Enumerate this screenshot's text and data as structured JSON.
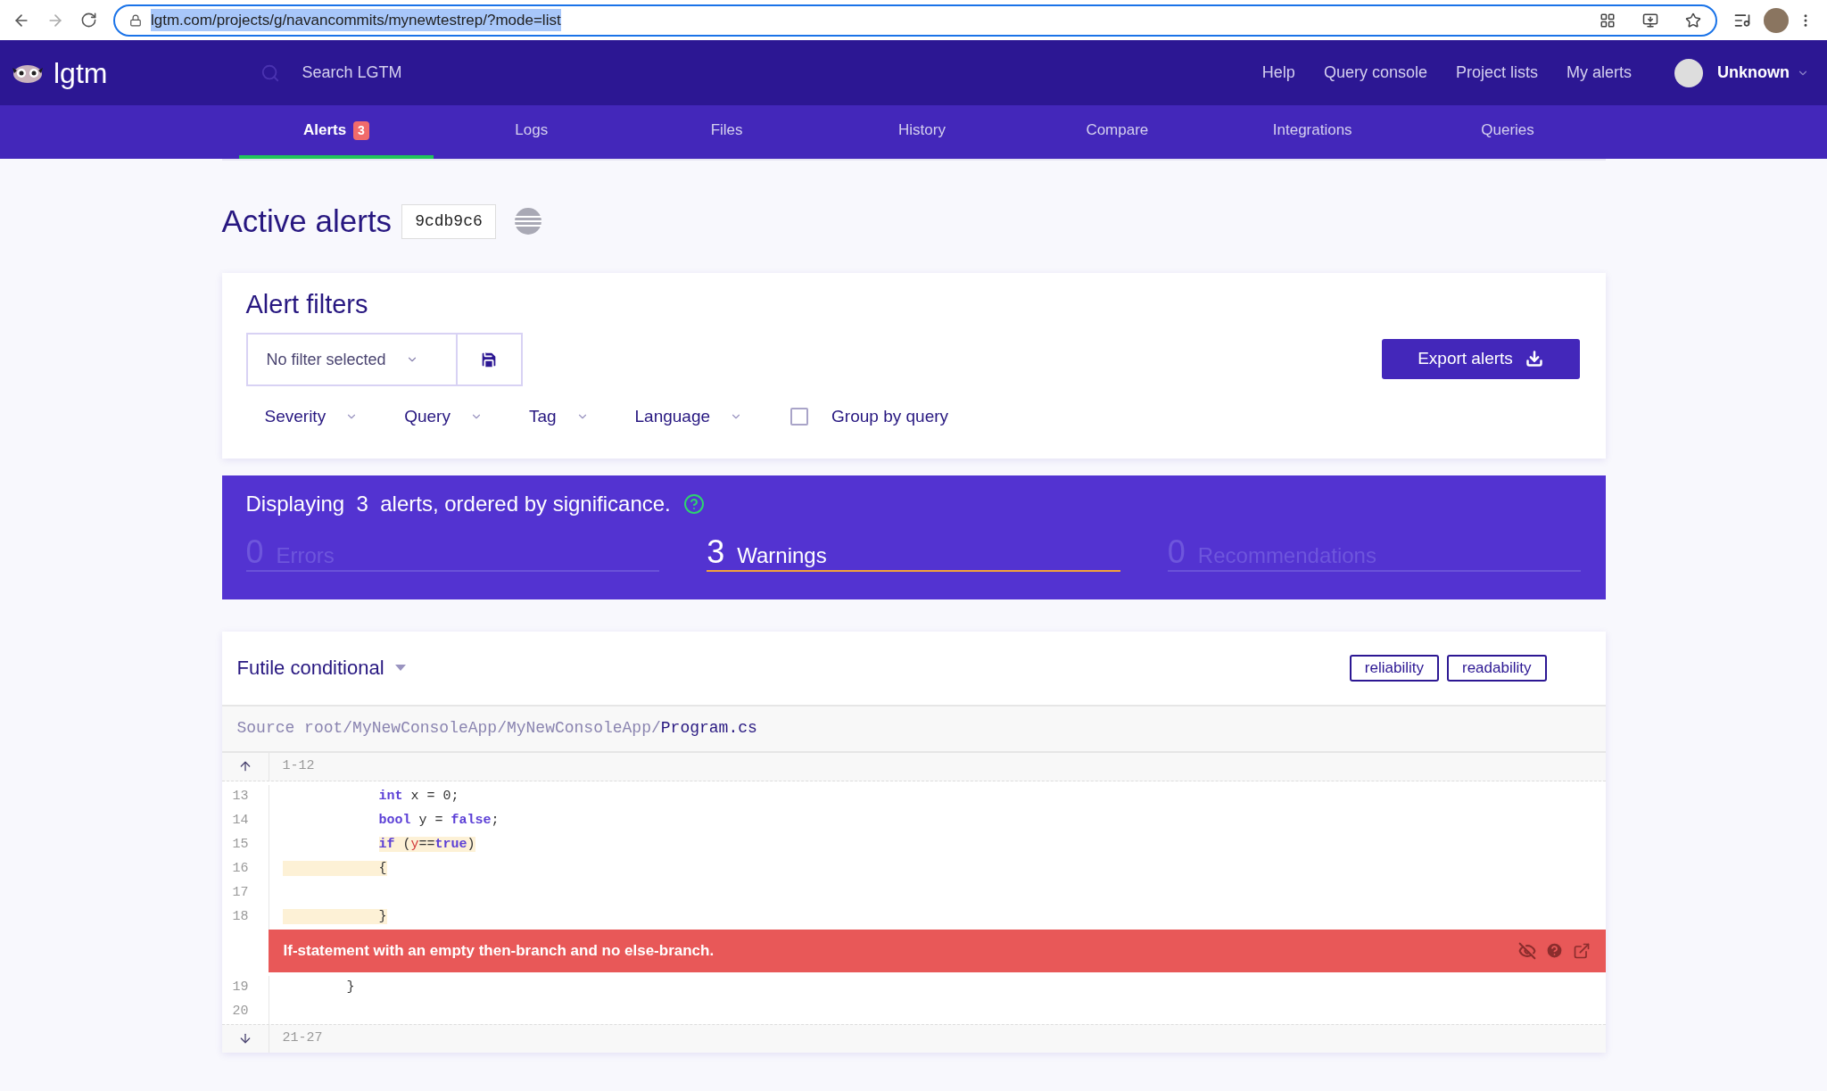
{
  "browser": {
    "url": "lgtm.com/projects/g/navancommits/mynewtestrep/?mode=list"
  },
  "header": {
    "logo": "lgtm",
    "search": {
      "placeholder": "Search LGTM"
    },
    "links": [
      "Help",
      "Query console",
      "Project lists",
      "My alerts"
    ],
    "user": "Unknown"
  },
  "tabs": [
    {
      "label": "Alerts",
      "badge": "3",
      "selected": true
    },
    {
      "label": "Logs",
      "selected": false
    },
    {
      "label": "Files",
      "selected": false
    },
    {
      "label": "History",
      "selected": false
    },
    {
      "label": "Compare",
      "selected": false
    },
    {
      "label": "Integrations",
      "selected": false
    },
    {
      "label": "Queries",
      "selected": false
    }
  ],
  "page": {
    "title": "Active alerts",
    "commit": "9cdb9c6"
  },
  "filters": {
    "title": "Alert filters",
    "preset": "No filter selected",
    "export_button": "Export alerts",
    "dropdowns": [
      "Severity",
      "Query",
      "Tag",
      "Language"
    ],
    "group_by": {
      "label": "Group by query",
      "checked": false
    }
  },
  "summary": {
    "text": "Displaying  3  alerts, ordered by significance.",
    "counts": [
      {
        "count": "0",
        "label": "Errors",
        "selected": false
      },
      {
        "count": "3",
        "label": "Warnings",
        "selected": true
      },
      {
        "count": "0",
        "label": "Recommendations",
        "selected": false
      }
    ]
  },
  "alert": {
    "title": "Futile conditional",
    "tags": [
      "reliability",
      "readability"
    ],
    "source_prefix": "Source root/MyNewConsoleApp/MyNewConsoleApp/",
    "source_file": "Program.cs",
    "range_before": "1-12",
    "range_after": "21-27",
    "lines_before": [
      {
        "number": "13",
        "kind": "nested",
        "indent_highlighted": false,
        "tokens": [
          {
            "kind": "keyword",
            "text": "int",
            "highlighted": false
          },
          {
            "kind": "plain",
            "text": " x = 0;",
            "highlighted": false
          }
        ]
      },
      {
        "number": "14",
        "kind": "nested",
        "indent_highlighted": false,
        "tokens": [
          {
            "kind": "keyword",
            "text": "bool",
            "highlighted": false
          },
          {
            "kind": "plain",
            "text": " y = ",
            "highlighted": false
          },
          {
            "kind": "keyword",
            "text": "false",
            "highlighted": false
          },
          {
            "kind": "plain",
            "text": ";",
            "highlighted": false
          }
        ]
      },
      {
        "number": "15",
        "kind": "nested",
        "indent_highlighted": false,
        "tokens": [
          {
            "kind": "keyword",
            "text": "if",
            "highlighted": true
          },
          {
            "kind": "plain",
            "text": " (",
            "highlighted": true
          },
          {
            "kind": "variable",
            "text": "y",
            "highlighted": true
          },
          {
            "kind": "plain",
            "text": "==",
            "highlighted": true
          },
          {
            "kind": "keyword",
            "text": "true",
            "highlighted": true
          },
          {
            "kind": "plain",
            "text": ")",
            "highlighted": true
          }
        ]
      },
      {
        "number": "16",
        "kind": "nested",
        "indent_highlighted": true,
        "tokens": [
          {
            "kind": "plain",
            "text": "{",
            "highlighted": true
          }
        ]
      },
      {
        "number": "17"
      },
      {
        "number": "18",
        "kind": "nested",
        "indent_highlighted": true,
        "tokens": [
          {
            "kind": "plain",
            "text": "}",
            "highlighted": true
          }
        ]
      }
    ],
    "message": "If-statement with an empty then-branch and no else-branch.",
    "lines_after": [
      {
        "number": "19",
        "kind": "outer",
        "indent_highlighted": false,
        "tokens": [
          {
            "kind": "plain",
            "text": "}",
            "highlighted": false
          }
        ]
      },
      {
        "number": "20"
      }
    ]
  }
}
